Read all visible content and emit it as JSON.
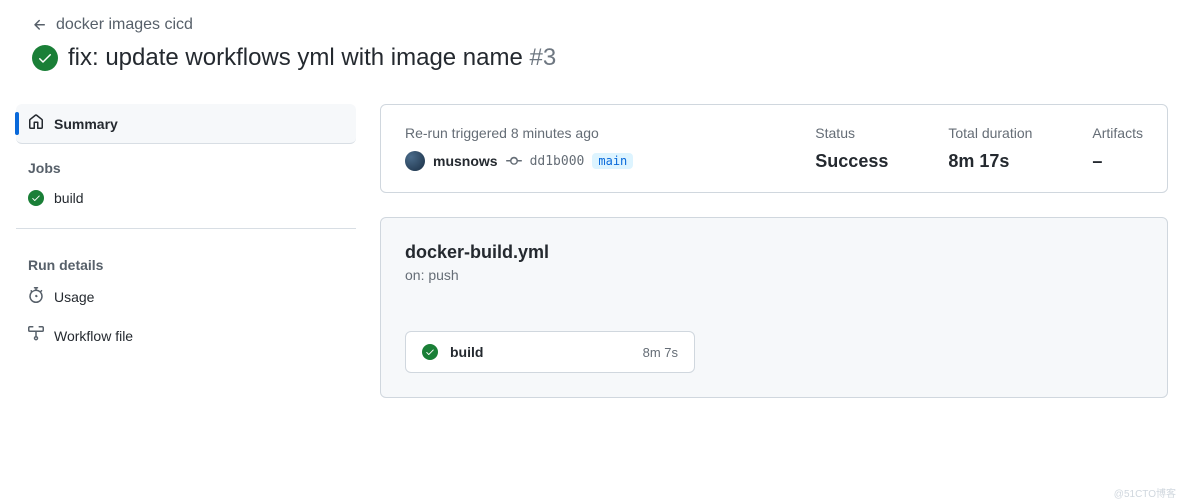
{
  "breadcrumb": {
    "text": "docker images cicd"
  },
  "title": {
    "text": "fix: update workflows yml with image name",
    "number": "#3"
  },
  "sidebar": {
    "summary_label": "Summary",
    "jobs_heading": "Jobs",
    "jobs": [
      {
        "label": "build"
      }
    ],
    "run_details_heading": "Run details",
    "usage_label": "Usage",
    "workflow_file_label": "Workflow file"
  },
  "summary": {
    "triggered_text": "Re-run triggered 8 minutes ago",
    "username": "musnows",
    "commit_sha": "dd1b000",
    "branch": "main",
    "status_label": "Status",
    "status_value": "Success",
    "duration_label": "Total duration",
    "duration_value": "8m 17s",
    "artifacts_label": "Artifacts",
    "artifacts_value": "–"
  },
  "workflow": {
    "filename": "docker-build.yml",
    "trigger": "on: push",
    "job_name": "build",
    "job_duration": "8m 7s"
  },
  "watermark": "@51CTO博客"
}
